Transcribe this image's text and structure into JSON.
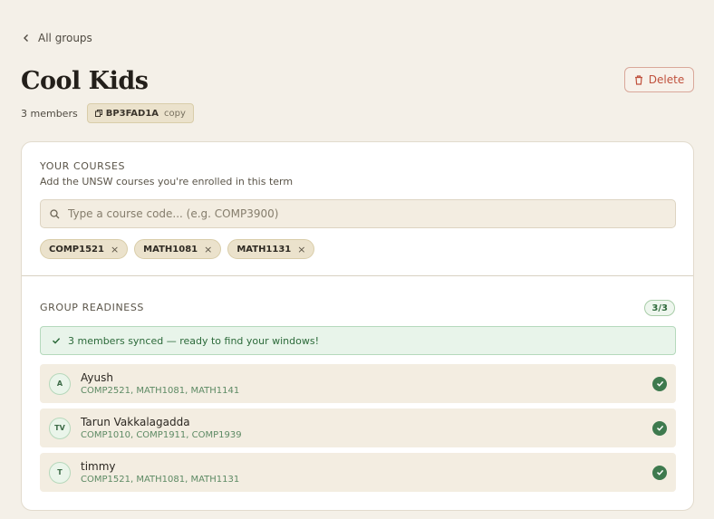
{
  "nav": {
    "back_label": "All groups"
  },
  "group": {
    "name": "Cool Kids",
    "members_count": "3 members",
    "code": "BP3FAD1A",
    "copy_label": "copy",
    "delete_label": "Delete"
  },
  "courses": {
    "heading": "YOUR COURSES",
    "subtitle": "Add the UNSW courses you're enrolled in this term",
    "search_placeholder": "Type a course code... (e.g. COMP3900)",
    "selected": [
      {
        "code": "COMP1521",
        "remove": "×"
      },
      {
        "code": "MATH1081",
        "remove": "×"
      },
      {
        "code": "MATH1131",
        "remove": "×"
      }
    ]
  },
  "readiness": {
    "heading": "GROUP READINESS",
    "count": "3/3",
    "synced_message": "3 members synced — ready to find your windows!",
    "members": [
      {
        "initials": "A",
        "name": "Ayush",
        "courses": "COMP2521, MATH1081, MATH1141",
        "ready": true
      },
      {
        "initials": "TV",
        "name": "Tarun Vakkalagadda",
        "courses": "COMP1010, COMP1911, COMP1939",
        "ready": true
      },
      {
        "initials": "T",
        "name": "timmy",
        "courses": "COMP1521, MATH1081, MATH1131",
        "ready": true
      }
    ]
  },
  "colors": {
    "background": "#f4f0e8",
    "danger": "#c0513d",
    "success": "#3e7a4e",
    "chip": "#ebe2cc"
  }
}
